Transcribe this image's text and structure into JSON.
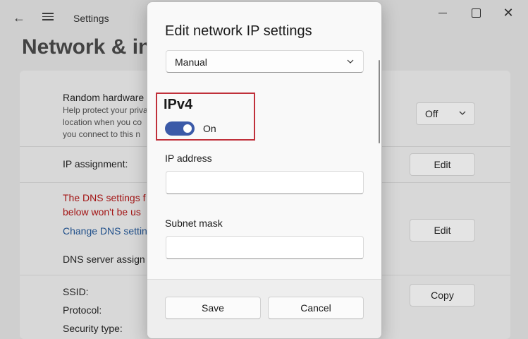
{
  "window": {
    "title": "Settings"
  },
  "background": {
    "page_heading": "Network & in",
    "random_hw": {
      "label": "Random hardware",
      "description_lines": [
        "Help protect your privacy",
        "location when you co",
        "you connect to this n"
      ],
      "dropdown_value": "Off"
    },
    "ip_assignment": {
      "label": "IP assignment:",
      "button": "Edit"
    },
    "dns_warning_lines": [
      "The DNS settings f",
      "below won't be us"
    ],
    "change_dns_link": "Change DNS settin",
    "dns_edit_button": "Edit",
    "dns_server_label": "DNS server assign",
    "ssid_label": "SSID:",
    "protocol_label": "Protocol:",
    "security_label": "Security type:",
    "copy_button": "Copy"
  },
  "dialog": {
    "title": "Edit network IP settings",
    "mode_select": {
      "value": "Manual"
    },
    "ipv4": {
      "heading": "IPv4",
      "toggle_state": "On",
      "toggle_on": true
    },
    "fields": {
      "ip_address": {
        "label": "IP address",
        "value": ""
      },
      "subnet_mask": {
        "label": "Subnet mask",
        "value": ""
      }
    },
    "buttons": {
      "save": "Save",
      "cancel": "Cancel"
    }
  },
  "colors": {
    "accent": "#3b5aa8",
    "highlight_border": "#c0303a",
    "warning_text": "#a31515",
    "link_text": "#1f4f8a"
  },
  "icons": [
    "back-arrow-icon",
    "hamburger-menu-icon",
    "minimize-icon",
    "maximize-icon",
    "close-icon",
    "chevron-down-icon"
  ]
}
